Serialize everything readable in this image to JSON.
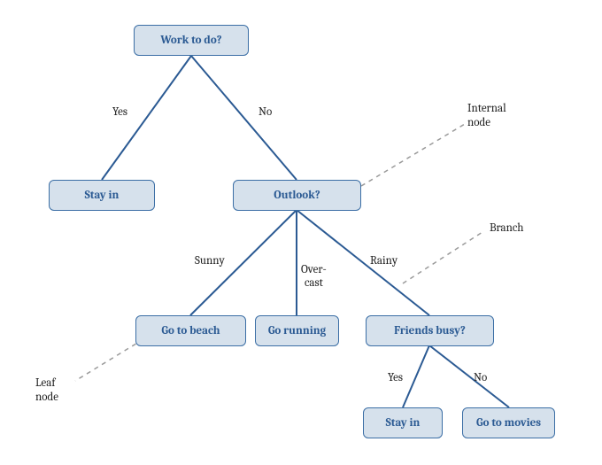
{
  "nodes": {
    "root": {
      "label": "Work to do?"
    },
    "stayin1": {
      "label": "Stay in"
    },
    "outlook": {
      "label": "Outlook?"
    },
    "beach": {
      "label": "Go to beach"
    },
    "running": {
      "label": "Go running"
    },
    "friends": {
      "label": "Friends busy?"
    },
    "stayin2": {
      "label": "Stay in"
    },
    "movies": {
      "label": "Go to movies"
    }
  },
  "edges": {
    "root_yes": {
      "label": "Yes"
    },
    "root_no": {
      "label": "No"
    },
    "outlook_sunny": {
      "label": "Sunny"
    },
    "outlook_over": {
      "label": "Over-\ncast"
    },
    "outlook_rainy": {
      "label": "Rainy"
    },
    "friends_yes": {
      "label": "Yes"
    },
    "friends_no": {
      "label": "No"
    }
  },
  "annotations": {
    "internal": {
      "label": "Internal\nnode"
    },
    "branch": {
      "label": "Branch"
    },
    "leaf": {
      "label": "Leaf\nnode"
    }
  }
}
